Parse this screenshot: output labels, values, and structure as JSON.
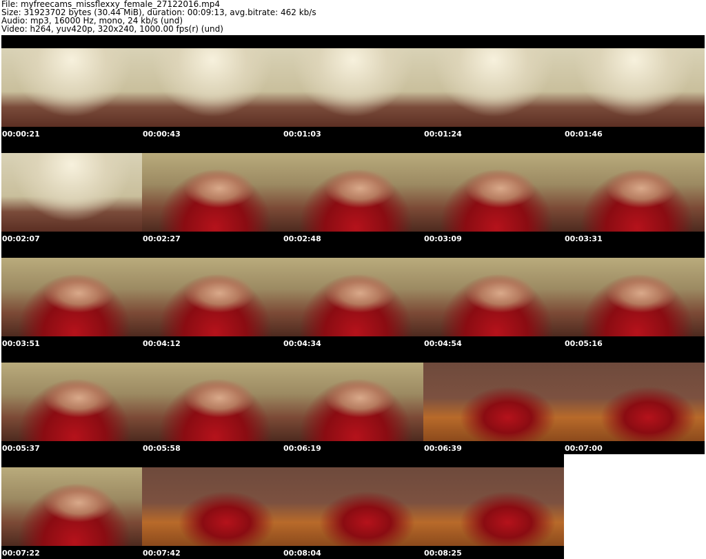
{
  "header": {
    "file": "File: myfreecams_missflexxy_female_27122016.mp4",
    "size": "Size: 31923702 bytes (30.44 MiB), duration: 00:09:13, avg.bitrate: 462 kb/s",
    "audio": "Audio: mp3, 16000 Hz, mono, 24 kb/s (und)",
    "video": "Video: h264, yuv420p, 320x240, 1000.00 fps(r) (und)"
  },
  "frames": [
    {
      "time": "00:00:21",
      "scene": "room"
    },
    {
      "time": "00:00:43",
      "scene": "room"
    },
    {
      "time": "00:01:03",
      "scene": "room"
    },
    {
      "time": "00:01:24",
      "scene": "room"
    },
    {
      "time": "00:01:46",
      "scene": "room"
    },
    {
      "time": "00:02:07",
      "scene": "room"
    },
    {
      "time": "00:02:27",
      "scene": "person"
    },
    {
      "time": "00:02:48",
      "scene": "person"
    },
    {
      "time": "00:03:09",
      "scene": "person"
    },
    {
      "time": "00:03:31",
      "scene": "person"
    },
    {
      "time": "00:03:51",
      "scene": "person"
    },
    {
      "time": "00:04:12",
      "scene": "person"
    },
    {
      "time": "00:04:34",
      "scene": "person"
    },
    {
      "time": "00:04:54",
      "scene": "person"
    },
    {
      "time": "00:05:16",
      "scene": "person"
    },
    {
      "time": "00:05:37",
      "scene": "person"
    },
    {
      "time": "00:05:58",
      "scene": "person"
    },
    {
      "time": "00:06:19",
      "scene": "person"
    },
    {
      "time": "00:06:39",
      "scene": "floor"
    },
    {
      "time": "00:07:00",
      "scene": "floor"
    },
    {
      "time": "00:07:22",
      "scene": "person"
    },
    {
      "time": "00:07:42",
      "scene": "floor"
    },
    {
      "time": "00:08:04",
      "scene": "floor"
    },
    {
      "time": "00:08:25",
      "scene": "floor"
    }
  ]
}
